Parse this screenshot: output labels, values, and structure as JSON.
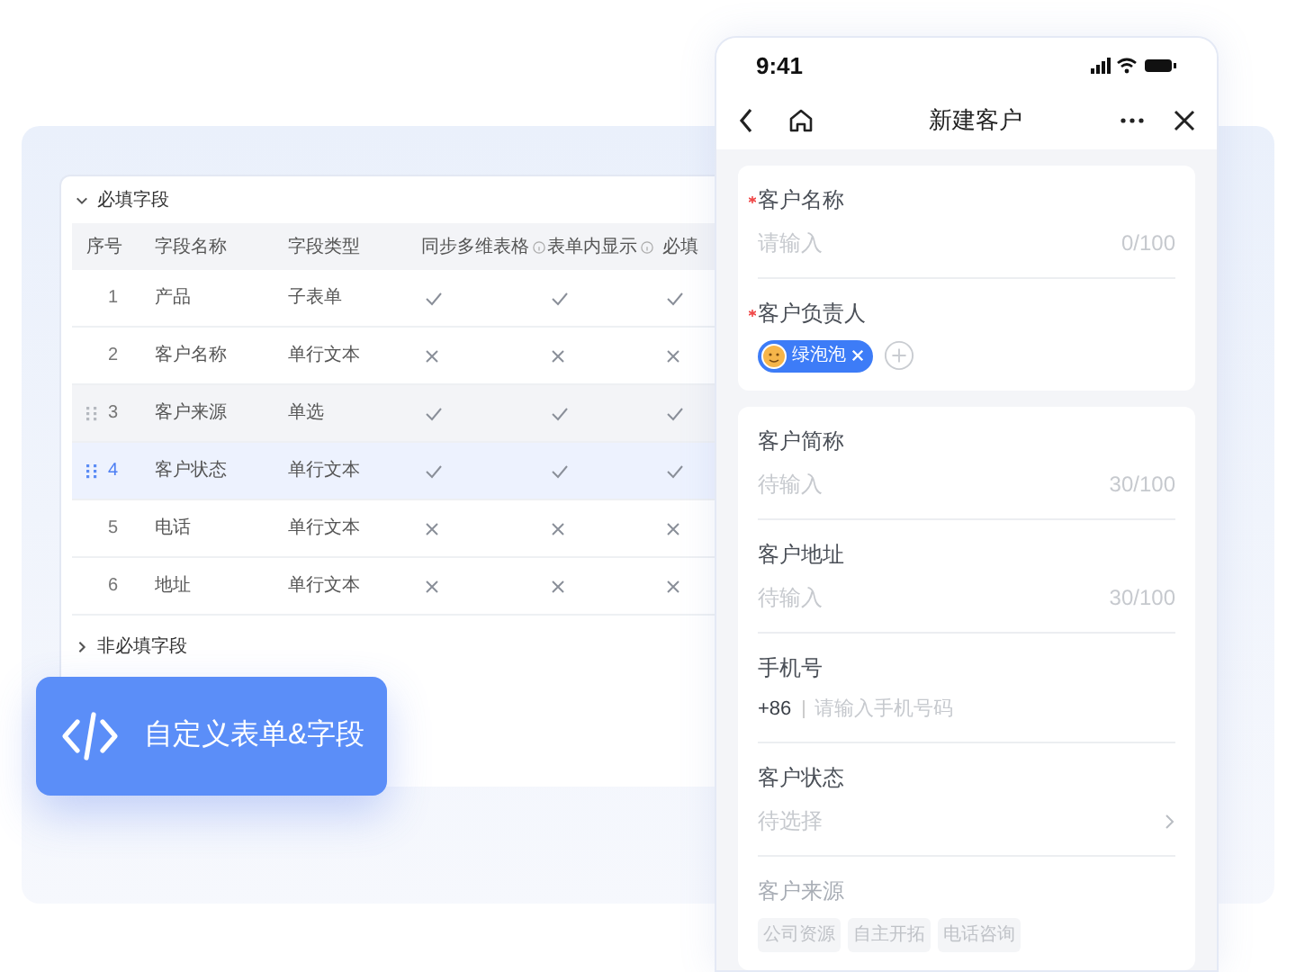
{
  "table_panel": {
    "sections": [
      {
        "title": "必填字段",
        "expanded": true
      },
      {
        "title": "非必填字段",
        "expanded": false
      }
    ],
    "columns": [
      {
        "label": "序号",
        "info": false
      },
      {
        "label": "字段名称",
        "info": false
      },
      {
        "label": "字段类型",
        "info": false
      },
      {
        "label": "同步多维表格",
        "info": true
      },
      {
        "label": "表单内显示",
        "info": true
      },
      {
        "label": "必填",
        "info": false
      }
    ],
    "rows": [
      {
        "index": "1",
        "name": "产品",
        "type": "子表单",
        "sync": true,
        "show": true,
        "required": true,
        "hovered": false,
        "selected": false
      },
      {
        "index": "2",
        "name": "客户名称",
        "type": "单行文本",
        "sync": false,
        "show": false,
        "required": false,
        "hovered": false,
        "selected": false
      },
      {
        "index": "3",
        "name": "客户来源",
        "type": "单选",
        "sync": true,
        "show": true,
        "required": true,
        "hovered": true,
        "selected": false
      },
      {
        "index": "4",
        "name": "客户状态",
        "type": "单行文本",
        "sync": true,
        "show": true,
        "required": true,
        "hovered": false,
        "selected": true
      },
      {
        "index": "5",
        "name": "电话",
        "type": "单行文本",
        "sync": false,
        "show": false,
        "required": false,
        "hovered": false,
        "selected": false
      },
      {
        "index": "6",
        "name": "地址",
        "type": "单行文本",
        "sync": false,
        "show": false,
        "required": false,
        "hovered": false,
        "selected": false
      }
    ]
  },
  "feature_badge": {
    "label": "自定义表单&字段"
  },
  "phone": {
    "status_bar": {
      "time": "9:41"
    },
    "nav": {
      "title": "新建客户"
    },
    "cards": [
      {
        "fields": [
          {
            "kind": "text",
            "label": "客户名称",
            "required": true,
            "placeholder": "请输入",
            "counter": "0/100"
          },
          {
            "kind": "people",
            "label": "客户负责人",
            "required": true,
            "people": [
              {
                "name": "绿泡泡"
              }
            ]
          }
        ]
      },
      {
        "fields": [
          {
            "kind": "text",
            "label": "客户简称",
            "required": false,
            "placeholder": "待输入",
            "counter": "30/100"
          },
          {
            "kind": "text",
            "label": "客户地址",
            "required": false,
            "placeholder": "待输入",
            "counter": "30/100"
          },
          {
            "kind": "phone",
            "label": "手机号",
            "required": false,
            "code": "+86",
            "placeholder": "请输入手机号码"
          },
          {
            "kind": "select",
            "label": "客户状态",
            "required": false,
            "placeholder": "待选择"
          },
          {
            "kind": "options",
            "label": "客户来源",
            "required": false,
            "options": [
              "公司资源",
              "自主开拓",
              "电话咨询"
            ]
          }
        ]
      }
    ]
  }
}
